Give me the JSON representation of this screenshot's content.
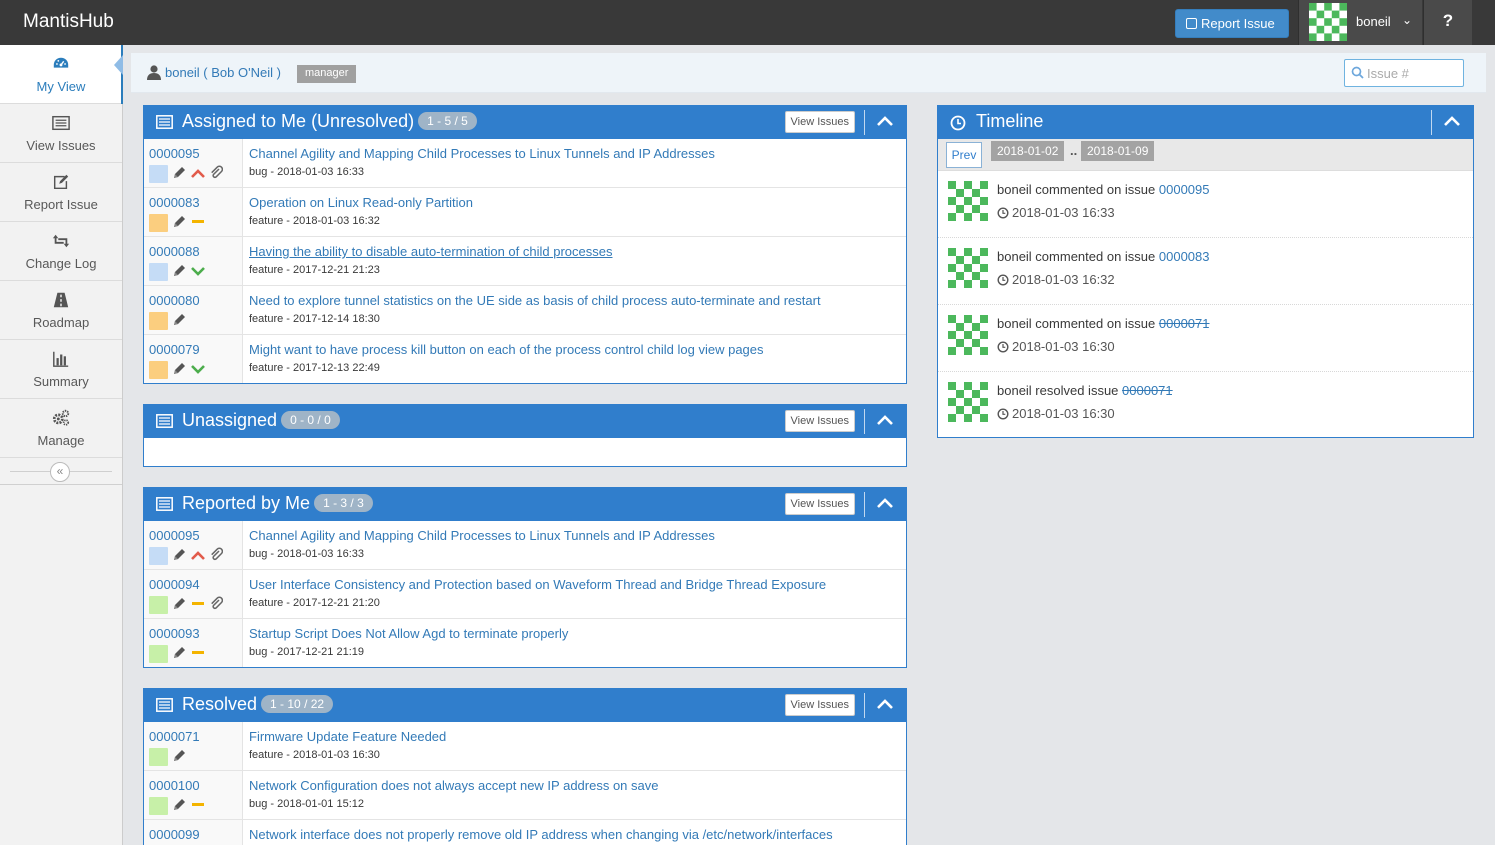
{
  "app": {
    "brand": "MantisHub"
  },
  "header": {
    "report_issue_label": "Report Issue",
    "username": "boneil",
    "help_label": "?"
  },
  "sidebar": {
    "items": [
      {
        "label": "My View",
        "icon": "dashboard-icon"
      },
      {
        "label": "View Issues",
        "icon": "list-icon"
      },
      {
        "label": "Report Issue",
        "icon": "edit-icon"
      },
      {
        "label": "Change Log",
        "icon": "retweet-icon"
      },
      {
        "label": "Roadmap",
        "icon": "road-icon"
      },
      {
        "label": "Summary",
        "icon": "bar-chart-icon"
      },
      {
        "label": "Manage",
        "icon": "gears-icon"
      }
    ]
  },
  "breadcrumb": {
    "user": "boneil ( Bob O'Neil )",
    "role": "manager",
    "search_placeholder": "Issue #"
  },
  "colors": {
    "navbar": "#393939",
    "widget_header": "#307ecc",
    "status_new": "#c5dcf6",
    "status_feedback": "#fbce7f",
    "status_resolved": "#c7f0a8",
    "priority_high": "#e25b4b",
    "priority_normal": "#f4b400",
    "priority_low": "#4cad4c"
  },
  "widgets": {
    "assigned": {
      "title": "Assigned to Me (Unresolved)",
      "badge": "1 - 5 / 5",
      "view_label": "View Issues",
      "rows": [
        {
          "id": "0000095",
          "summary": "Channel Agility and Mapping Child Processes to Linux Tunnels and IP Addresses",
          "meta": "bug - 2018-01-03 16:33",
          "status": "#c5dcf6",
          "priority": "high",
          "attach": true
        },
        {
          "id": "0000083",
          "summary": "Operation on Linux Read-only Partition",
          "meta": "feature - 2018-01-03 16:32",
          "status": "#fbce7f",
          "priority": "normal",
          "attach": false
        },
        {
          "id": "0000088",
          "summary": "Having the ability to disable auto-termination of child processes",
          "meta": "feature - 2017-12-21 21:23",
          "status": "#c5dcf6",
          "priority": "low",
          "attach": false
        },
        {
          "id": "0000080",
          "summary": "Need to explore tunnel statistics on the UE side as basis of child process auto-terminate and restart",
          "meta": "feature - 2017-12-14 18:30",
          "status": "#fbce7f",
          "priority": "none",
          "attach": false
        },
        {
          "id": "0000079",
          "summary": "Might want to have process kill button on each of the process control child log view pages",
          "meta": "feature - 2017-12-13 22:49",
          "status": "#fbce7f",
          "priority": "low",
          "attach": false
        }
      ]
    },
    "unassigned": {
      "title": "Unassigned",
      "badge": "0 - 0 / 0",
      "view_label": "View Issues",
      "rows": []
    },
    "reported": {
      "title": "Reported by Me",
      "badge": "1 - 3 / 3",
      "view_label": "View Issues",
      "rows": [
        {
          "id": "0000095",
          "summary": "Channel Agility and Mapping Child Processes to Linux Tunnels and IP Addresses",
          "meta": "bug - 2018-01-03 16:33",
          "status": "#c5dcf6",
          "priority": "high",
          "attach": true
        },
        {
          "id": "0000094",
          "summary": "User Interface Consistency and Protection based on Waveform Thread and Bridge Thread Exposure",
          "meta": "feature - 2017-12-21 21:20",
          "status": "#c7f0a8",
          "priority": "normal",
          "attach": true
        },
        {
          "id": "0000093",
          "summary": "Startup Script Does Not Allow Agd to terminate properly",
          "meta": "bug - 2017-12-21 21:19",
          "status": "#c7f0a8",
          "priority": "normal",
          "attach": false
        }
      ]
    },
    "resolved": {
      "title": "Resolved",
      "badge": "1 - 10 / 22",
      "view_label": "View Issues",
      "rows": [
        {
          "id": "0000071",
          "summary": "Firmware Update Feature Needed",
          "meta": "feature - 2018-01-03 16:30",
          "status": "#c7f0a8",
          "priority": "none",
          "attach": false
        },
        {
          "id": "0000100",
          "summary": "Network Configuration does not always accept new IP address on save",
          "meta": "bug - 2018-01-01 15:12",
          "status": "#c7f0a8",
          "priority": "normal",
          "attach": false
        },
        {
          "id": "0000099",
          "summary": "Network interface does not properly remove old IP address when changing via /etc/network/interfaces",
          "meta": "",
          "status": "#c7f0a8",
          "priority": "none",
          "attach": false
        }
      ]
    }
  },
  "timeline": {
    "title": "Timeline",
    "prev_label": "Prev",
    "date_from": "2018-01-02",
    "date_sep": "..",
    "date_to": "2018-01-09",
    "items": [
      {
        "text": "boneil commented on issue ",
        "issue": "0000095",
        "struck": false,
        "time": "2018-01-03 16:33"
      },
      {
        "text": "boneil commented on issue ",
        "issue": "0000083",
        "struck": false,
        "time": "2018-01-03 16:32"
      },
      {
        "text": "boneil commented on issue ",
        "issue": "0000071",
        "struck": true,
        "time": "2018-01-03 16:30"
      },
      {
        "text": "boneil resolved issue ",
        "issue": "0000071",
        "struck": true,
        "time": "2018-01-03 16:30"
      }
    ]
  }
}
